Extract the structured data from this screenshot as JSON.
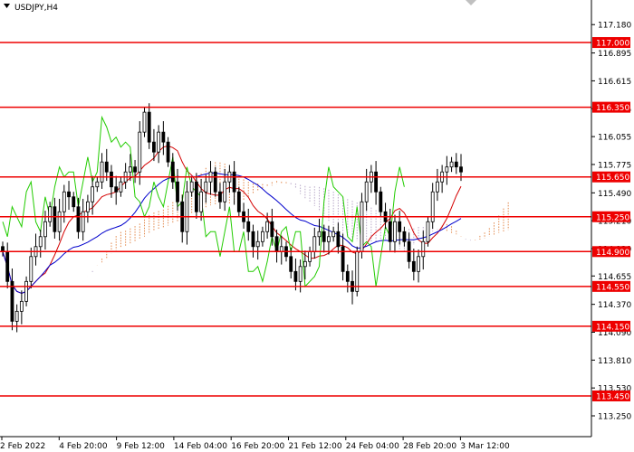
{
  "chart_data": {
    "type": "candlestick",
    "title": "USDJPY,H4",
    "ylim": [
      113.25,
      117.3
    ],
    "price_ticks": [
      "117.180",
      "116.895",
      "116.615",
      "116.335",
      "116.055",
      "115.775",
      "115.490",
      "115.210",
      "114.930",
      "114.655",
      "114.370",
      "114.090",
      "113.810",
      "113.530",
      "113.250"
    ],
    "levels": [
      "117.000",
      "116.350",
      "115.650",
      "115.250",
      "114.900",
      "114.550",
      "114.150",
      "113.450"
    ],
    "time_labels": [
      "2 Feb 2022",
      "4 Feb 20:00",
      "9 Feb 12:00",
      "14 Feb 04:00",
      "16 Feb 20:00",
      "21 Feb 12:00",
      "24 Feb 04:00",
      "28 Feb 20:00",
      "3 Mar 12:00"
    ],
    "closes": [
      114.9,
      114.6,
      114.2,
      114.3,
      114.4,
      114.6,
      114.85,
      114.95,
      115.05,
      115.2,
      115.35,
      115.1,
      115.3,
      115.5,
      115.45,
      115.35,
      115.1,
      115.3,
      115.4,
      115.55,
      115.6,
      115.8,
      115.7,
      115.55,
      115.5,
      115.6,
      115.7,
      115.75,
      115.7,
      116.1,
      116.3,
      116.0,
      115.9,
      116.1,
      116.0,
      115.8,
      115.6,
      115.4,
      115.1,
      115.5,
      115.6,
      115.3,
      115.5,
      115.6,
      115.7,
      115.5,
      115.4,
      115.6,
      115.7,
      115.5,
      115.3,
      115.2,
      115.1,
      114.95,
      115.0,
      115.1,
      115.2,
      115.05,
      114.9,
      114.95,
      114.85,
      114.7,
      114.6,
      114.75,
      114.8,
      114.9,
      115.05,
      115.1,
      115.0,
      115.05,
      115.1,
      114.95,
      114.7,
      114.6,
      114.5,
      114.9,
      115.4,
      115.6,
      115.7,
      115.5,
      115.3,
      115.2,
      115.0,
      115.2,
      115.1,
      115.0,
      114.8,
      114.7,
      114.85,
      115.0,
      115.2,
      115.5,
      115.6,
      115.7,
      115.75,
      115.8,
      115.75,
      115.7
    ],
    "colors": {
      "candle": "#000000",
      "tenkan": "#d40000",
      "kijun": "#0000cc",
      "chikou": "#22cc00",
      "cloud_up": "#e2894d",
      "cloud_down": "#b8a8c8",
      "level_line": "#ee0000",
      "level_label_bg": "#ee0000"
    },
    "grid": false
  }
}
